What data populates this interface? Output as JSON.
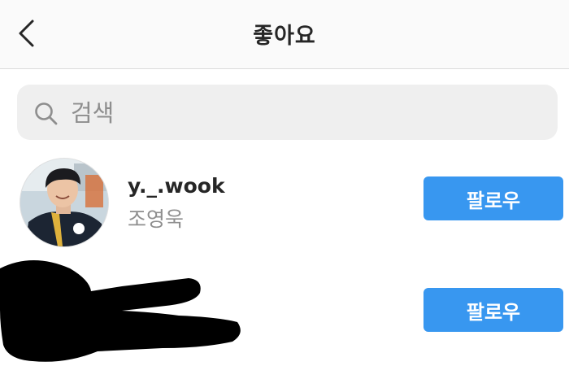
{
  "header": {
    "title": "좋아요",
    "back_icon": "chevron-left-icon"
  },
  "search": {
    "placeholder": "검색",
    "value": "",
    "icon": "search-icon"
  },
  "users": [
    {
      "username": "y._.wook",
      "fullname": "조영욱",
      "follow_label": "팔로우"
    },
    {
      "username": "",
      "fullname": "",
      "follow_label": "팔로우",
      "redacted": true
    }
  ],
  "colors": {
    "accent": "#3897f0",
    "text": "#262626",
    "secondary_text": "#8e8e8e",
    "search_bg": "#efefef",
    "header_bg": "#fafafa"
  }
}
